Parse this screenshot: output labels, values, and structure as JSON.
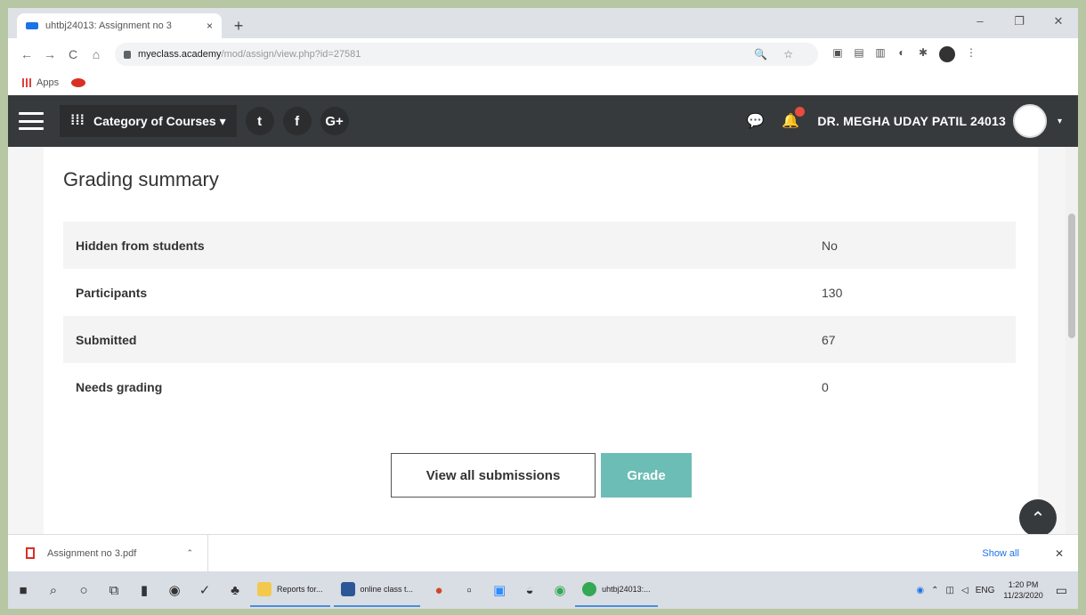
{
  "browser": {
    "tab_title": "uhtbj24013: Assignment no 3",
    "tab_close": "×",
    "new_tab": "+",
    "window_controls": [
      "–",
      "❐",
      "✕"
    ],
    "nav": [
      "←",
      "→",
      "C",
      "⌂"
    ],
    "url_host": "myeclass.academy",
    "url_path": "/mod/assign/view.php?id=27581",
    "bookmarks_apps": "Apps"
  },
  "sitenav": {
    "category_label": "Category of Courses ▾",
    "social": [
      "t",
      "f",
      "G+"
    ],
    "user_name": "DR. MEGHA UDAY PATIL 24013",
    "caret": "▾"
  },
  "summary": {
    "heading": "Grading summary",
    "rows": [
      {
        "label": "Hidden from students",
        "value": "No"
      },
      {
        "label": "Participants",
        "value": "130"
      },
      {
        "label": "Submitted",
        "value": "67"
      },
      {
        "label": "Needs grading",
        "value": "0"
      }
    ],
    "view_all_label": "View all submissions",
    "grade_label": "Grade"
  },
  "downloads": {
    "file_name": "Assignment no 3.pdf",
    "show_all": "Show all",
    "close": "✕"
  },
  "taskbar": {
    "apps": [
      {
        "label": "Reports for...",
        "color": "#f2c94c"
      },
      {
        "label": "online class t...",
        "color": "#2b5797"
      },
      {
        "label": "uhtbj24013:...",
        "color": "#34a853"
      }
    ],
    "lang": "ENG",
    "time": "1:20 PM",
    "date": "11/23/2020"
  }
}
